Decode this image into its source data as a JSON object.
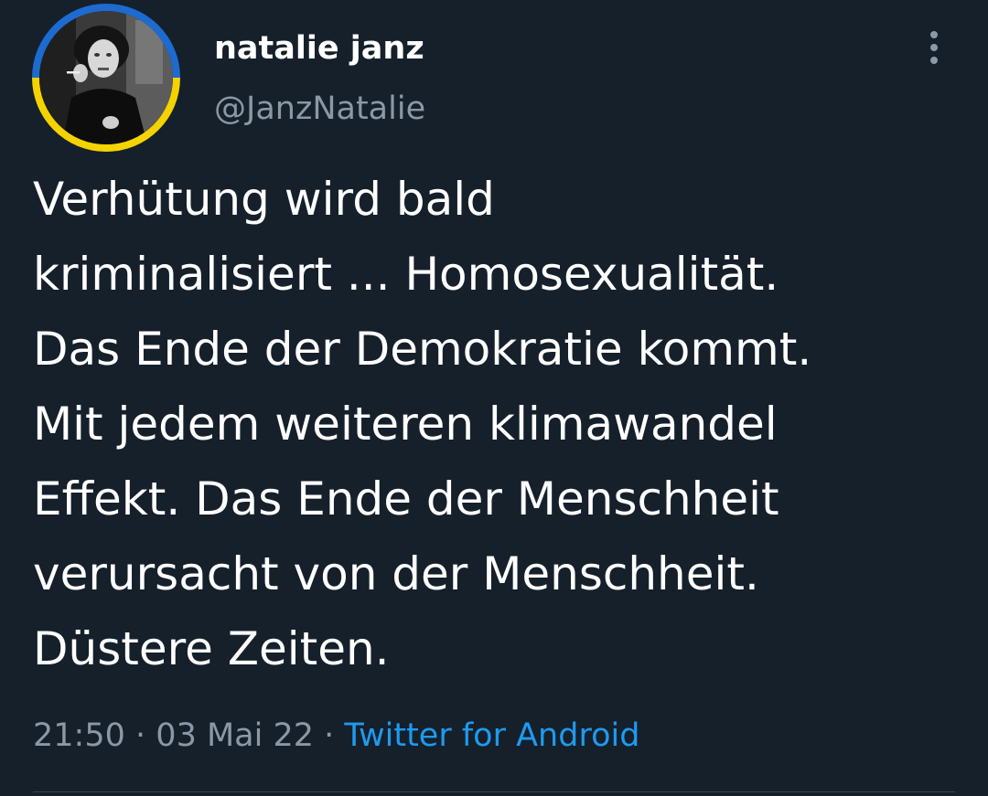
{
  "author": {
    "display_name": "natalie janz",
    "handle": "@JanzNatalie",
    "avatar_ring_colors": [
      "#1d6bd1",
      "#f5d300"
    ]
  },
  "menu": {
    "icon": "more-vertical-icon"
  },
  "tweet": {
    "lines": [
      "Verhütung wird bald",
      "kriminalisiert ... Homosexualität.",
      "Das Ende der Demokratie kommt.",
      "Mit jedem weiteren klimawandel",
      "Effekt. Das Ende der Menschheit",
      "verursacht von der Menschheit.",
      "Düstere Zeiten."
    ]
  },
  "meta": {
    "time": "21:50",
    "separator": "·",
    "date": "03 Mai 22",
    "source": "Twitter for Android"
  },
  "colors": {
    "background": "#15202b",
    "text": "#ffffff",
    "secondary_text": "#8b98a5",
    "link": "#1d9bf0"
  }
}
